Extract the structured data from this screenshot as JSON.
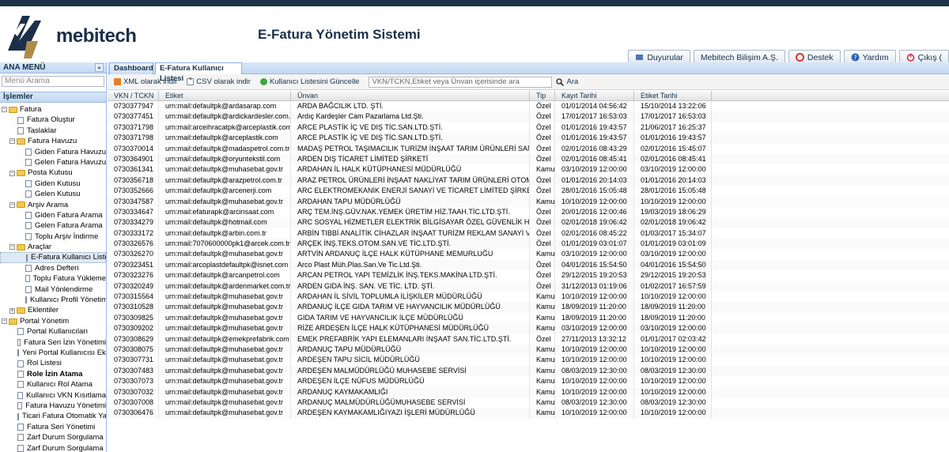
{
  "header": {
    "brand": "mebitech",
    "app_title": "E-Fatura Yönetim Sistemi",
    "buttons": [
      "Duyurular",
      "Mebitech Bilişim A.Ş.",
      "Destek",
      "Yardım",
      "Çıkış ("
    ]
  },
  "sidebar": {
    "title": "ANA MENÜ",
    "collapse": "«",
    "search_placeholder": "Menü Arama",
    "section": "İşlemler",
    "tree": [
      {
        "label": "Fatura",
        "level": 0,
        "type": "folder",
        "pm": "−"
      },
      {
        "label": "Fatura Oluştur",
        "level": 1,
        "type": "leaf"
      },
      {
        "label": "Taslaklar",
        "level": 1,
        "type": "leaf"
      },
      {
        "label": "Fatura Havuzu",
        "level": 1,
        "type": "folder",
        "pm": "−"
      },
      {
        "label": "Giden Fatura Havuzu",
        "level": 2,
        "type": "leaf"
      },
      {
        "label": "Gelen Fatura Havuzu",
        "level": 2,
        "type": "leaf"
      },
      {
        "label": "Posta Kutusu",
        "level": 1,
        "type": "folder",
        "pm": "−"
      },
      {
        "label": "Giden Kutusu",
        "level": 2,
        "type": "leaf"
      },
      {
        "label": "Gelen Kutusu",
        "level": 2,
        "type": "leaf"
      },
      {
        "label": "Arşiv Arama",
        "level": 1,
        "type": "folder",
        "pm": "−"
      },
      {
        "label": "Giden Fatura Arama",
        "level": 2,
        "type": "leaf"
      },
      {
        "label": "Gelen Fatura Arama",
        "level": 2,
        "type": "leaf"
      },
      {
        "label": "Toplu Arşiv İndirme",
        "level": 2,
        "type": "leaf"
      },
      {
        "label": "Araçlar",
        "level": 1,
        "type": "folder",
        "pm": "−"
      },
      {
        "label": "E-Fatura Kullanıcı Listesi",
        "level": 2,
        "type": "leaf",
        "selected": true
      },
      {
        "label": "Adres Defteri",
        "level": 2,
        "type": "leaf"
      },
      {
        "label": "Toplu Fatura Yükleme",
        "level": 2,
        "type": "leaf"
      },
      {
        "label": "Mail Yönlendirme",
        "level": 2,
        "type": "leaf"
      },
      {
        "label": "Kullanıcı Profil Yönetimi",
        "level": 2,
        "type": "leaf"
      },
      {
        "label": "Eklentiler",
        "level": 1,
        "type": "folder",
        "pm": "+"
      },
      {
        "label": "Portal Yönetim",
        "level": 0,
        "type": "folder",
        "pm": "−"
      },
      {
        "label": "Portal Kullanıcıları",
        "level": 1,
        "type": "leaf"
      },
      {
        "label": "Fatura Seri İzin Yönetimi",
        "level": 1,
        "type": "leaf"
      },
      {
        "label": "Yeni Portal Kullanıcısı Ekleme",
        "level": 1,
        "type": "leaf"
      },
      {
        "label": "Rol Listesi",
        "level": 1,
        "type": "leaf"
      },
      {
        "label": "Role İzin Atama",
        "level": 1,
        "type": "leaf",
        "bold": true
      },
      {
        "label": "Kullanıcı Rol Atama",
        "level": 1,
        "type": "leaf"
      },
      {
        "label": "Kullanıcı VKN Kısıtlama",
        "level": 1,
        "type": "leaf"
      },
      {
        "label": "Fatura Havuzu Yönetimi",
        "level": 1,
        "type": "leaf"
      },
      {
        "label": "Ticari Fatura Otomatik Yanıt Yö",
        "level": 1,
        "type": "leaf"
      },
      {
        "label": "Fatura Seri Yönetimi",
        "level": 1,
        "type": "leaf"
      },
      {
        "label": "Zarf Durum Sorgulama",
        "level": 1,
        "type": "leaf"
      },
      {
        "label": "Zarf Durum Sorgulama",
        "level": 1,
        "type": "leaf"
      }
    ]
  },
  "tabs": [
    {
      "label": "Dashboard"
    },
    {
      "label": "E-Fatura Kullanıcı Listesi",
      "close": "×"
    }
  ],
  "toolbar": {
    "xml": "XML olarak indir",
    "csv": "CSV olarak indir",
    "refresh": "Kullanıcı Listesini Güncelle",
    "search_placeholder": "VKN/TCKN,Etiket veya Ünvan içerisinde ara",
    "search_btn": "Ara"
  },
  "grid": {
    "columns": [
      "VKN / TCKN",
      "Etiket",
      "Ünvan",
      "Tip",
      "Kayıt Tarihi",
      "Etiket Tarihi"
    ],
    "rows": [
      [
        "0730377947",
        "urn:mail:defaultpk@ardasarap.com",
        "ARDA BAĞCILIK LTD. ŞTİ.",
        "Özel",
        "01/01/2014 04:56:42",
        "15/10/2014 13:22:06"
      ],
      [
        "0730377451",
        "urn:mail:defaultpk@ardickardesler.com.tr",
        "Ardıç Kardeşler Cam Pazarlama Ltd.Şti.",
        "Özel",
        "17/01/2017 16:53:03",
        "17/01/2017 16:53:03"
      ],
      [
        "0730371798",
        "urn:mail:arceihracatpk@arceplastik.com",
        "ARCE PLASTİK İÇ VE DIŞ TİC.SAN.LTD.ŞTİ.",
        "Özel",
        "01/01/2016 19:43:57",
        "21/06/2017 16:25:37"
      ],
      [
        "0730371798",
        "urn:mail:defaultpk@arceplastik.com",
        "ARCE PLASTİK İÇ VE DIŞ TİC.SAN.LTD.ŞTİ.",
        "Özel",
        "01/01/2016 19:43:57",
        "01/01/2016 19:43:57"
      ],
      [
        "0730370014",
        "urn:mail:defaultpk@madaspetrol.com.tr",
        "MADAŞ PETROL TAŞIMACILIK TURİZM İNŞAAT TARIM ÜRÜNLERİ SANAYİ VE TİCARET ...",
        "Özel",
        "02/01/2016 08:43:29",
        "02/01/2016 15:45:07"
      ],
      [
        "0730364901",
        "urn:mail:defaultpk@oryuntekstil.com",
        "ARDEN DIŞ TİCARET LİMİTED ŞİRKETİ",
        "Özel",
        "02/01/2016 08:45:41",
        "02/01/2016 08:45:41"
      ],
      [
        "0730361341",
        "urn:mail:defaultpk@muhasebat.gov.tr",
        "ARDAHAN İL HALK KÜTÜPHANESİ MÜDÜRLÜĞÜ",
        "Kamu",
        "03/10/2019 12:00:00",
        "03/10/2019 12:00:00"
      ],
      [
        "0730356718",
        "urn:mail:defaultpk@arazpetrol.com.tr",
        "ARAZ PETROL ÜRÜNLERİ İNŞAAT NAKLİYAT TARIM ÜRÜNLERİ OTOMOTİV TAAHHÜT S...",
        "Özel",
        "01/01/2016 20:14:03",
        "01/01/2016 20:14:03"
      ],
      [
        "0730352666",
        "urn:mail:defaultpk@arcenerji.com",
        "ARC ELEKTROMEKANİK ENERJİ SANAYİ VE TİCARET LİMİTED ŞİRKETİ",
        "Özel",
        "28/01/2016 15:05:48",
        "28/01/2016 15:05:48"
      ],
      [
        "0730347587",
        "urn:mail:defaultpk@muhasebat.gov.tr",
        "ARDAHAN TAPU MÜDÜRLÜĞÜ",
        "Kamu",
        "10/10/2019 12:00:00",
        "10/10/2019 12:00:00"
      ],
      [
        "0730334647",
        "urn:mail:efaturapk@arcinsaat.com",
        "ARÇ TEM.İNŞ.GÜV.NAK.YEMEK ÜRETİM HİZ.TAAH.TİC.LTD.ŞTİ.",
        "Özel",
        "20/01/2016 12:00:46",
        "19/03/2019 18:06:29"
      ],
      [
        "0730334279",
        "urn:mail:defaultpk@hotmail.com",
        "ARC SOSYAL HİZMETLER ELEKTRİK BİLGİSAYAR ÖZEL GÜVENLİK HİZMETLERİ ÖZEL S...",
        "Özel",
        "02/01/2018 19:06:42",
        "02/01/2018 19:06:42"
      ],
      [
        "0730333172",
        "urn:mail:defaultpk@arbin.com.tr",
        "ARBİN TIBBİ ANALİTİK CİHAZLAR İNŞAAT TURİZM REKLAM SANAYİ VE TİCARET LİMİT...",
        "Özel",
        "02/01/2016 08:45:22",
        "01/03/2017 15:34:07"
      ],
      [
        "0730326576",
        "urn:mail:7070600000pk1@arcek.com.tr",
        "ARÇEK İNŞ.TEKS.OTOM.SAN.VE TİC.LTD.ŞTİ.",
        "Özel",
        "01/01/2019 03:01:07",
        "01/01/2019 03:01:09"
      ],
      [
        "0730326270",
        "urn:mail:defaultpk@muhasebat.gov.tr",
        "ARTVİN ARDANUÇ İLÇE HALK KÜTÜPHANE MEMURLUĞU",
        "Kamu",
        "03/10/2019 12:00:00",
        "03/10/2019 12:00:00"
      ],
      [
        "0730323451",
        "urn:mail:arcoplastdefaultpk@isnet.com",
        "Arco Plast Müh.Plas.San.Ve Tic.Ltd.Şti.",
        "Özel",
        "04/01/2016 15:54:50",
        "04/01/2016 15:54:50"
      ],
      [
        "0730323276",
        "urn:mail:defaultpk@arcanpetrol.com",
        "ARCAN PETROL YAPI TEMİZLİK İNŞ.TEKS.MAKİNA LTD.ŞTİ.",
        "Özel",
        "29/12/2015 19:20:53",
        "29/12/2015 19:20:53"
      ],
      [
        "0730320249",
        "urn:mail:defaultpk@ardenmarket.com.tr",
        "ARDEN GIDA İNŞ. SAN. VE TİC. LTD. ŞTİ.",
        "Özel",
        "31/12/2013 01:19:06",
        "01/02/2017 16:57:59"
      ],
      [
        "0730315564",
        "urn:mail:defaultpk@muhasebat.gov.tr",
        "ARDAHAN İL SİVİL TOPLUMLA İLİŞKİLER MÜDÜRLÜĞÜ",
        "Kamu",
        "10/10/2019 12:00:00",
        "10/10/2019 12:00:00"
      ],
      [
        "0730310528",
        "urn:mail:defaultpk@muhasebat.gov.tr",
        "ARDANUÇ İLÇE GIDA TARIM VE HAYVANCILIK MÜDÜRLÜĞÜ",
        "Kamu",
        "18/09/2019 11:20:00",
        "18/09/2019 11:20:00"
      ],
      [
        "0730309825",
        "urn:mail:defaultpk@muhasebat.gov.tr",
        "GIDA TARIM VE HAYVANCILIK İLÇE MÜDÜRLÜĞÜ",
        "Kamu",
        "18/09/2019 11:20:00",
        "18/09/2019 11:20:00"
      ],
      [
        "0730309202",
        "urn:mail:defaultpk@muhasebat.gov.tr",
        "RİZE ARDEŞEN İLÇE HALK KÜTÜPHANESİ MÜDÜRLÜĞÜ",
        "Kamu",
        "03/10/2019 12:00:00",
        "03/10/2019 12:00:00"
      ],
      [
        "0730308629",
        "urn:mail:defaultpk@emekprefabrik.com",
        "EMEK PREFABRİK YAPI ELEMANLARI İNŞAAT SAN.TİC.LTD.ŞTİ.",
        "Özel",
        "27/11/2013 13:32:12",
        "01/01/2017 02:03:42"
      ],
      [
        "0730308075",
        "urn:mail:defaultpk@muhasebat.gov.tr",
        "ARDANUÇ TAPU MÜDÜRLÜĞÜ",
        "Kamu",
        "10/10/2019 12:00:00",
        "10/10/2019 12:00:00"
      ],
      [
        "0730307731",
        "urn:mail:defaultpk@muhasebat.gov.tr",
        "ARDEŞEN TAPU SİCİL MÜDÜRLÜĞÜ",
        "Kamu",
        "10/10/2019 12:00:00",
        "10/10/2019 12:00:00"
      ],
      [
        "0730307483",
        "urn:mail:defaultpk@muhasebat.gov.tr",
        "ARDEŞEN MALMÜDÜRLÜĞÜ MUHASEBE SERVİSİ",
        "Kamu",
        "08/03/2019 12:30:00",
        "08/03/2019 12:30:00"
      ],
      [
        "0730307073",
        "urn:mail:defaultpk@muhasebat.gov.tr",
        "ARDEŞEN İLÇE NÜFUS MÜDÜRLÜĞÜ",
        "Kamu",
        "10/10/2019 12:00:00",
        "10/10/2019 12:00:00"
      ],
      [
        "0730307032",
        "urn:mail:defaultpk@muhasebat.gov.tr",
        "ARDANUÇ KAYMAKAMLIĞI",
        "Kamu",
        "10/10/2019 12:00:00",
        "10/10/2019 12:00:00"
      ],
      [
        "0730307008",
        "urn:mail:defaultpk@muhasebat.gov.tr",
        "ARDANUÇ MALMÜDÜRLÜĞÜMUHASEBE SERVİSİ",
        "Kamu",
        "08/03/2019 12:30:00",
        "08/03/2019 12:30:00"
      ],
      [
        "0730306476",
        "urn:mail:defaultpk@muhasebat.gov.tr",
        "ARDEŞEN KAYMAKAMLIĞIYAZI İŞLERİ MÜDÜRLÜĞÜ",
        "Kamu",
        "10/10/2019 12:00:00",
        "10/10/2019 12:00:00"
      ]
    ]
  }
}
